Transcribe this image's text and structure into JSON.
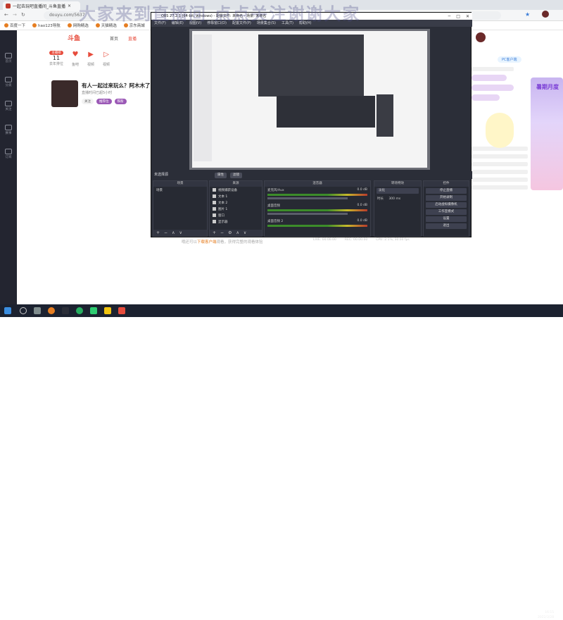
{
  "browser": {
    "tab_title": "一起去玩吧直播间_斗鱼直播",
    "url": "douyu.com/5637",
    "bookmarks": [
      "百度一下",
      "hao123导航",
      "网购精选",
      "天猫精选",
      "京东商城"
    ]
  },
  "watermark": "大家来到直播间 点点关注谢谢大家",
  "site": {
    "logo": "斗鱼",
    "nav": [
      "首页",
      "直播"
    ],
    "stats": [
      {
        "pill": "主播榜",
        "value": "11",
        "label": "去年排位"
      },
      {
        "pill": "",
        "value": "",
        "label": "鱼吧"
      },
      {
        "pill": "",
        "value": "",
        "label": "视频"
      },
      {
        "pill": "",
        "value": "",
        "label": "视频"
      }
    ],
    "streamer": {
      "title": "有人一起过来玩么？阿木木了",
      "meta": "直播时间已超5小时",
      "tags": [
        "关注",
        "推荐位",
        "铁粉"
      ]
    },
    "rail_items": [
      "首页",
      "分类",
      "关注",
      "赛事",
      "订阅"
    ],
    "hint_prefix": "哦还可以",
    "hint_link": "下载客户端",
    "hint_suffix": "观看，获得完整的观看体验",
    "pc_pill": "PC客户端",
    "promo": "暑期月度",
    "right_buttons": [
      "",
      "",
      "",
      ""
    ]
  },
  "obs": {
    "title": "OBS 27.2.1 (64-bit, windows) - 配置文件: 未命名 - 场景: 未命名",
    "menu": [
      "文件(F)",
      "编辑(E)",
      "视图(V)",
      "停靠窗口(D)",
      "配置文件(P)",
      "场景集合(S)",
      "工具(T)",
      "帮助(H)"
    ],
    "no_source": "未选择源",
    "chips": [
      "属性",
      "滤镜"
    ],
    "docks": {
      "scenes": "场景",
      "sources": "来源",
      "mixer": "混音器",
      "transitions": "转场特效",
      "controls": "控件"
    },
    "scene_items": [
      "场景"
    ],
    "source_items": [
      "视频捕获设备",
      "文本 1",
      "文本 2",
      "图片 1",
      "窗口",
      "显示器"
    ],
    "mixer_items": [
      {
        "name": "麦克风/Aux",
        "db": "0.0 dB"
      },
      {
        "name": "桌面音频",
        "db": "0.0 dB"
      },
      {
        "name": "桌面音频 2",
        "db": "0.0 dB"
      }
    ],
    "transition": {
      "type": "淡化",
      "duration_label": "时长",
      "duration": "300 ms"
    },
    "controls": [
      "停止直播",
      "开始录制",
      "启动虚拟摄像机",
      "工作室模式",
      "设置",
      "退出"
    ],
    "status": [
      "LIVE: 00:00:00",
      "REC: 00:00:00",
      "CPU: 2.1%, 30.00 fps"
    ]
  },
  "taskbar": {
    "time": "16:15",
    "date": "2022/3/28"
  }
}
